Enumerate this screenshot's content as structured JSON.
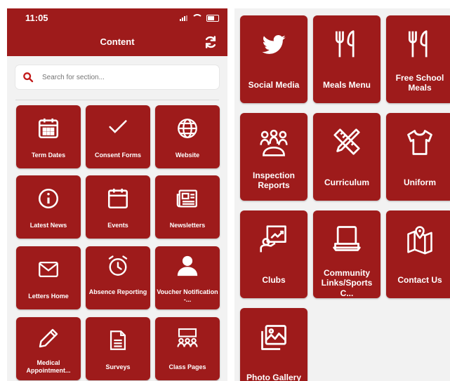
{
  "status_bar": {
    "time": "11:05"
  },
  "header": {
    "title": "Content"
  },
  "search": {
    "placeholder": "Search for section..."
  },
  "left_tiles": [
    {
      "label": "Term Dates",
      "icon": "calendar-grid-icon"
    },
    {
      "label": "Consent Forms",
      "icon": "checkmark-icon"
    },
    {
      "label": "Website",
      "icon": "globe-icon"
    },
    {
      "label": "Latest News",
      "icon": "info-icon"
    },
    {
      "label": "Events",
      "icon": "calendar-icon"
    },
    {
      "label": "Newsletters",
      "icon": "newspaper-icon"
    },
    {
      "label": "Letters Home",
      "icon": "envelope-icon"
    },
    {
      "label": "Absence Reporting",
      "icon": "alarm-clock-icon"
    },
    {
      "label": "Voucher Notification -...",
      "icon": "person-icon"
    },
    {
      "label": "Medical Appointment...",
      "icon": "pencil-icon"
    },
    {
      "label": "Surveys",
      "icon": "document-icon"
    },
    {
      "label": "Class Pages",
      "icon": "classroom-icon"
    }
  ],
  "right_tiles": [
    {
      "label": "Social Media",
      "icon": "twitter-bird-icon"
    },
    {
      "label": "Meals Menu",
      "icon": "fork-knife-icon"
    },
    {
      "label": "Free School Meals",
      "icon": "fork-knife-icon"
    },
    {
      "label": "Inspection Reports",
      "icon": "group-icon"
    },
    {
      "label": "Curriculum",
      "icon": "pencil-ruler-icon"
    },
    {
      "label": "Uniform",
      "icon": "tshirt-icon"
    },
    {
      "label": "Clubs",
      "icon": "presenter-chart-icon"
    },
    {
      "label": "Community Links/Sports C...",
      "icon": "laptop-icon"
    },
    {
      "label": "Contact Us",
      "icon": "map-pin-icon"
    },
    {
      "label": "Photo Gallery",
      "icon": "photo-gallery-icon"
    }
  ],
  "colors": {
    "brand": "#9e1b1b",
    "background": "#f2f2f2",
    "text_on_brand": "#ffffff"
  }
}
